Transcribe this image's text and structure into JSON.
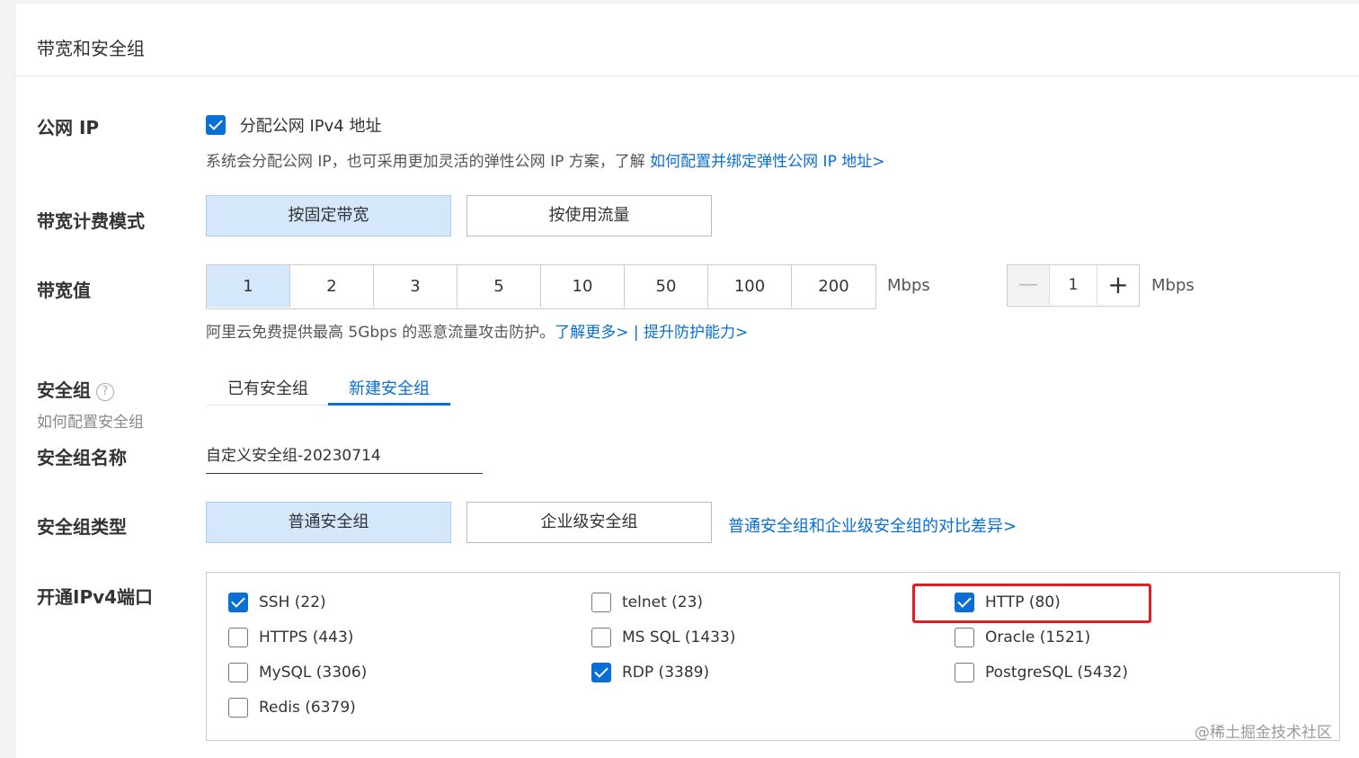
{
  "panel": {
    "title": "带宽和安全组"
  },
  "public_ip": {
    "label": "公网 IP",
    "checkbox_label": "分配公网 IPv4 地址",
    "checked": true,
    "description": "系统会分配公网 IP，也可采用更加灵活的弹性公网 IP 方案，了解 ",
    "link": "如何配置并绑定弹性公网 IP 地址>"
  },
  "billing": {
    "label": "带宽计费模式",
    "options": [
      "按固定带宽",
      "按使用流量"
    ],
    "selected": "按固定带宽"
  },
  "bandwidth": {
    "label": "带宽值",
    "presets": [
      "1",
      "2",
      "3",
      "5",
      "10",
      "50",
      "100",
      "200"
    ],
    "selected": "1",
    "unit": "Mbps",
    "stepper_value": "1",
    "stepper_unit": "Mbps",
    "note": "阿里云免费提供最高 5Gbps 的恶意流量攻击防护。",
    "link_learn": "了解更多>",
    "separator": "|",
    "link_upgrade": "提升防护能力>"
  },
  "security_group": {
    "label": "安全组",
    "help_link": "如何配置安全组",
    "tabs": [
      "已有安全组",
      "新建安全组"
    ],
    "active_tab": "新建安全组",
    "name_label": "安全组名称",
    "name_value": "自定义安全组-20230714",
    "type_label": "安全组类型",
    "types": [
      "普通安全组",
      "企业级安全组"
    ],
    "selected_type": "普通安全组",
    "type_compare_link": "普通安全组和企业级安全组的对比差异>"
  },
  "ports": {
    "label": "开通IPv4端口",
    "items": [
      {
        "label": "SSH (22)",
        "checked": true
      },
      {
        "label": "telnet (23)",
        "checked": false
      },
      {
        "label": "HTTP (80)",
        "checked": true
      },
      {
        "label": "HTTPS (443)",
        "checked": false
      },
      {
        "label": "MS SQL (1433)",
        "checked": false
      },
      {
        "label": "Oracle (1521)",
        "checked": false
      },
      {
        "label": "MySQL (3306)",
        "checked": false
      },
      {
        "label": "RDP (3389)",
        "checked": true
      },
      {
        "label": "PostgreSQL (5432)",
        "checked": false
      },
      {
        "label": "Redis (6379)",
        "checked": false
      }
    ]
  },
  "watermark": "@稀土掘金技术社区",
  "colors": {
    "accent": "#0a6fd4",
    "selected_bg": "#d4e7fb",
    "highlight": "#e51c23"
  }
}
